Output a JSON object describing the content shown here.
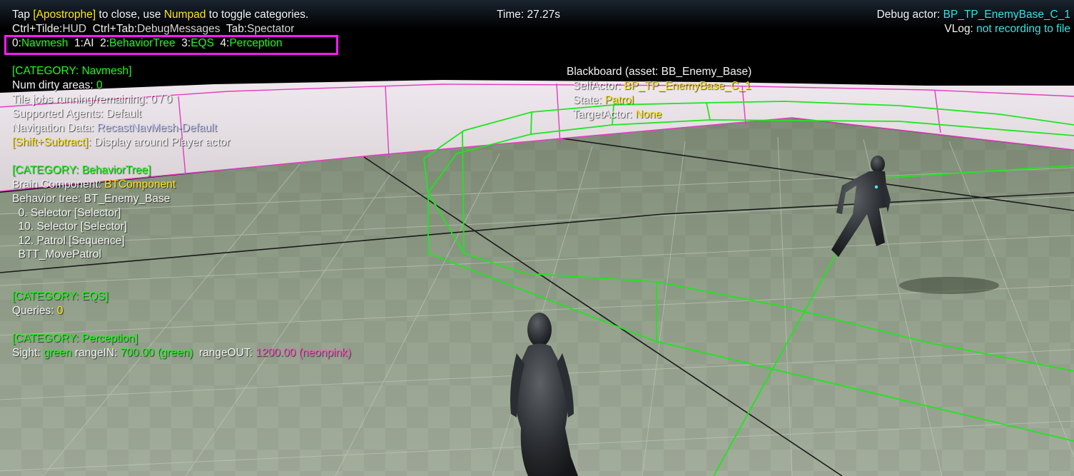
{
  "hud": {
    "help": {
      "tap": "Tap ",
      "apostrophe": "[Apostrophe]",
      "to_close": " to close, use ",
      "numpad": "Numpad",
      "to_toggle": " to toggle categories."
    },
    "shortcuts": {
      "tilde_key": "Ctrl+Tilde:",
      "tilde_val": "HUD",
      "tab_key": "  Ctrl+Tab:",
      "tab_val": "DebugMessages",
      "spec_key": "  Tab:",
      "spec_val": "Spectator"
    },
    "categories": [
      {
        "num": "0:",
        "label": "Navmesh",
        "active": true
      },
      {
        "num": "  1:",
        "label": "AI",
        "active": false
      },
      {
        "num": "  2:",
        "label": "BehaviorTree",
        "active": true
      },
      {
        "num": "  3:",
        "label": "EQS",
        "active": true
      },
      {
        "num": "  4:",
        "label": "Perception",
        "active": true
      }
    ],
    "time": "Time: 27.27s",
    "debug_actor_label": "Debug actor: ",
    "debug_actor_value": "BP_TP_EnemyBase_C_1",
    "vlog_label": "VLog: ",
    "vlog_value": "not recording to file"
  },
  "navmesh": {
    "header": "[CATEGORY: Navmesh]",
    "dirty_label": "Num dirty areas: ",
    "dirty_value": "0",
    "tile_jobs": "Tile jobs running/remaining: 0 / 0",
    "agents": "Supported Agents: Default",
    "nav_data_label": "Navigation Data: ",
    "nav_data_value": "RecastNavMesh-Default",
    "shift_key": "[Shift+Subtract]",
    "shift_text": ": Display around Player actor"
  },
  "behavior_tree": {
    "header": "[CATEGORY: BehaviorTree]",
    "brain_label": "Brain Component: ",
    "brain_value": "BTComponent",
    "tree": "Behavior tree: BT_Enemy_Base",
    "nodes": [
      "  0. Selector [Selector]",
      "  10. Selector [Selector]",
      "  12. Patrol [Sequence]",
      "  BTT_MovePatrol"
    ]
  },
  "eqs": {
    "header": "[CATEGORY: EQS]",
    "queries_label": "Queries: ",
    "queries_value": "0"
  },
  "perception": {
    "header": "[CATEGORY: Perception]",
    "sight_label": "Sight: ",
    "sight_color": "green",
    "range_in_label": " rangeIN: ",
    "range_in_value": "700.00 (green)",
    "range_out_label": "  rangeOUT: ",
    "range_out_value": "1200.00 (neonpink)"
  },
  "blackboard": {
    "header": "Blackboard (asset: BB_Enemy_Base)",
    "entries": [
      {
        "key": "  SelfActor: ",
        "value": "BP_TP_EnemyBase_C_1"
      },
      {
        "key": "  State: ",
        "value": "Patrol"
      },
      {
        "key": "  TargetActor: ",
        "value": "None"
      }
    ]
  },
  "colors": {
    "highlight": "#ff19ff",
    "category": "#19ff19",
    "value": "#ffe81a",
    "actor": "#33e6e6",
    "neonpink": "#ff58c8",
    "sight_cone": "#1ee61e",
    "floor": "#8f9e86"
  }
}
